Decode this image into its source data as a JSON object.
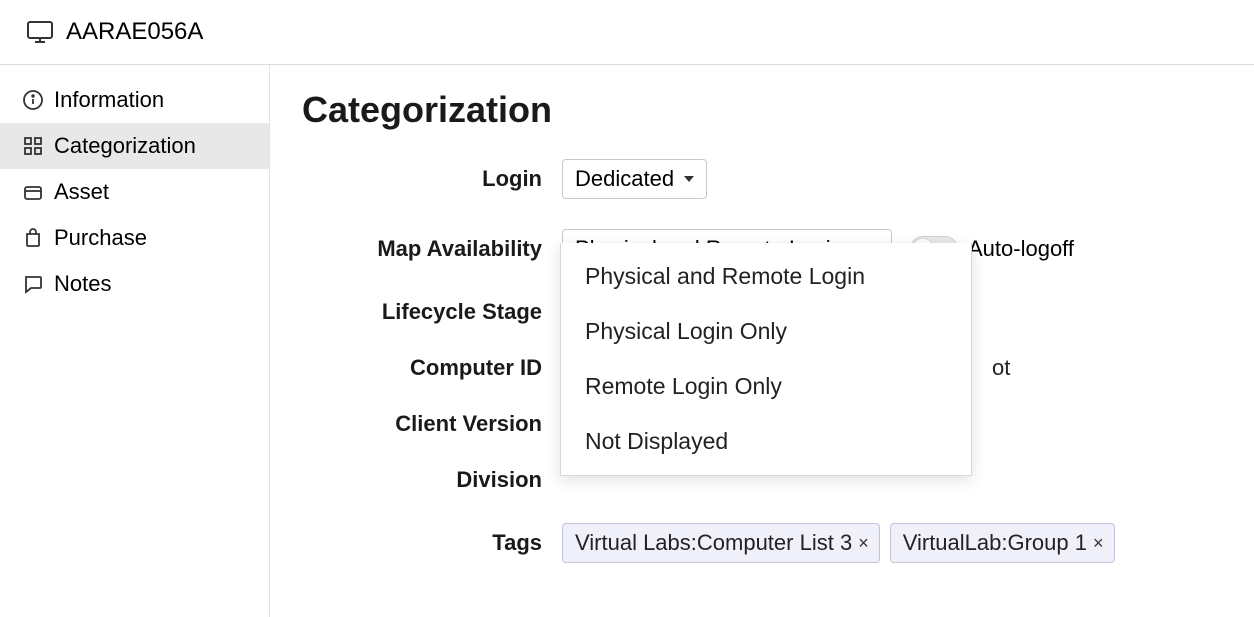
{
  "header": {
    "title": "AARAE056A"
  },
  "sidebar": {
    "items": [
      {
        "label": "Information",
        "icon": "info"
      },
      {
        "label": "Categorization",
        "icon": "grid"
      },
      {
        "label": "Asset",
        "icon": "asset"
      },
      {
        "label": "Purchase",
        "icon": "purchase"
      },
      {
        "label": "Notes",
        "icon": "notes"
      }
    ]
  },
  "main": {
    "title": "Categorization",
    "login": {
      "label": "Login",
      "value": "Dedicated"
    },
    "map_availability": {
      "label": "Map Availability",
      "value": "Physical and Remote Login",
      "options": [
        "Physical and Remote Login",
        "Physical Login Only",
        "Remote Login Only",
        "Not Displayed"
      ],
      "toggle_label": "Auto-logoff"
    },
    "lifecycle": {
      "label": "Lifecycle Stage"
    },
    "computer_id": {
      "label": "Computer ID",
      "value_fragment": "ot"
    },
    "client_version": {
      "label": "Client Version"
    },
    "division": {
      "label": "Division"
    },
    "tags": {
      "label": "Tags",
      "items": [
        "Virtual Labs:Computer List 3",
        "VirtualLab:Group 1"
      ]
    }
  }
}
